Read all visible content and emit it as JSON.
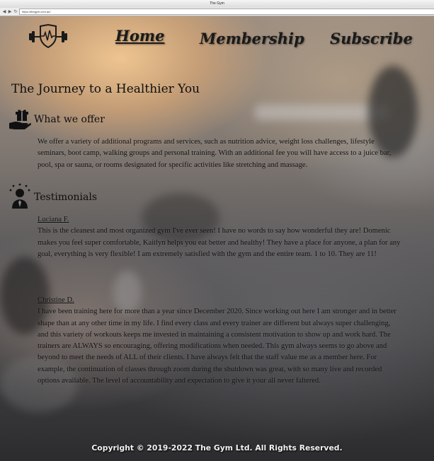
{
  "browser": {
    "window_title": "The Gym",
    "url": "https://thegym.com.au/"
  },
  "nav": {
    "logo_icon": "dumbbell-heartbeat-shield-icon",
    "items": [
      {
        "label": "Home",
        "active": true
      },
      {
        "label": "Membership",
        "active": false
      },
      {
        "label": "Subscribe",
        "active": false
      }
    ]
  },
  "hero": {
    "title": "The Journey to a Healthier You"
  },
  "offer": {
    "icon": "gift-hand-icon",
    "heading": "What we offer",
    "text": "We offer a variety of additional programs and services, such as nutrition advice, weight loss challenges, lifestyle seminars, boot camp, walking groups and personal training. With an additional fee you will have access to a juice bar, pool, spa or sauna, or rooms designated for specific activities like stretching and massage."
  },
  "testimonials": {
    "icon": "person-spotlight-icon",
    "heading": "Testimonials",
    "items": [
      {
        "name": "Luciana F.",
        "text": "This is the cleanest and most organized gym I've ever seen! I have no words to say how wonderful they are! Domenic makes you feel super comfortable, Kaitlyn helps you eat better and healthy! They have a place for anyone, a plan for any goal, everything is very flexible! I am extremely satisfied with the gym and the entire team. 1 to 10. They are 11!"
      },
      {
        "name": "Christine D.",
        "text": "I have been training here for more than a year since December 2020. Since working out here I am stronger and in better shape than at any other time in my life. I find every class and every trainer are different but always super challenging, and this variety of workouts keeps me invested in maintaining a consistent motivation to show up and work hard.  The trainers are ALWAYS so encouraging, offering modifications when needed.  This gym always seems to go above and beyond to meet the needs of ALL of their clients. I have always felt that the staff value me as a member here. For example, the continuation of classes through zoom during the shutdown was great, with so many live and recorded options available. The level of accountability and expectation to give it your all never faltered."
      }
    ]
  },
  "footer": {
    "copyright": "Copyright © 2019-2022 The Gym Ltd. All Rights Reserved."
  }
}
